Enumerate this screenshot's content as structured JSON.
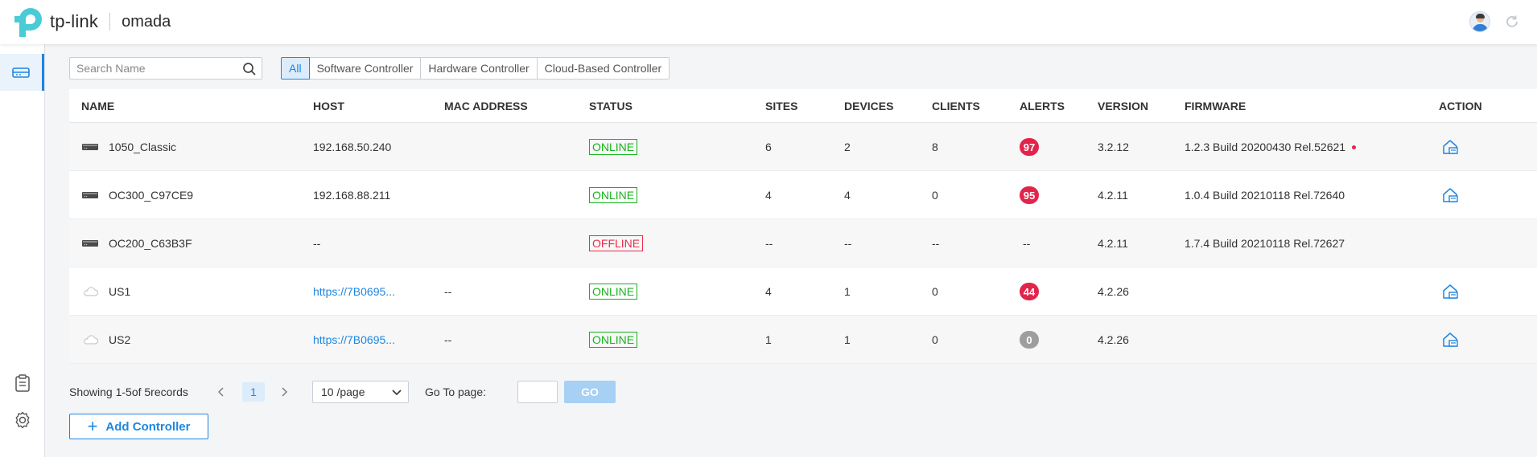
{
  "brand": {
    "name": "tp-link",
    "product": "omada",
    "accent": "#1f86e0"
  },
  "header": {
    "avatar_icon": "user-avatar-icon",
    "refresh_icon": "refresh-icon"
  },
  "sidebar": {
    "items": [
      {
        "icon": "controller-list-icon",
        "active": true
      },
      {
        "icon": "clipboard-icon",
        "active": false
      },
      {
        "icon": "gear-icon",
        "active": false
      }
    ]
  },
  "search": {
    "placeholder": "Search Name",
    "value": ""
  },
  "filters": [
    "All",
    "Software Controller",
    "Hardware Controller",
    "Cloud-Based Controller"
  ],
  "active_filter": "All",
  "table": {
    "columns": [
      "NAME",
      "HOST",
      "MAC ADDRESS",
      "STATUS",
      "SITES",
      "DEVICES",
      "CLIENTS",
      "ALERTS",
      "VERSION",
      "FIRMWARE",
      "ACTION"
    ],
    "rows": [
      {
        "type": "hardware",
        "name": "1050_Classic",
        "host": "192.168.50.240",
        "mac": "",
        "status": "ONLINE",
        "sites": "6",
        "devices": "2",
        "clients": "8",
        "alerts": "97",
        "version": "3.2.12",
        "firmware": "1.2.3 Build 20200430 Rel.52621",
        "firmware_update": true,
        "action": true
      },
      {
        "type": "hardware",
        "name": "OC300_C97CE9",
        "host": "192.168.88.211",
        "mac": "",
        "status": "ONLINE",
        "sites": "4",
        "devices": "4",
        "clients": "0",
        "alerts": "95",
        "version": "4.2.11",
        "firmware": "1.0.4 Build 20210118 Rel.72640",
        "firmware_update": false,
        "action": true
      },
      {
        "type": "hardware",
        "name": "OC200_C63B3F",
        "host": "--",
        "mac": "",
        "status": "OFFLINE",
        "sites": "--",
        "devices": "--",
        "clients": "--",
        "alerts": "--",
        "version": "4.2.11",
        "firmware": "1.7.4 Build 20210118 Rel.72627",
        "firmware_update": false,
        "action": false
      },
      {
        "type": "cloud",
        "name": "US1",
        "host": "https://7B0695...",
        "mac": "--",
        "status": "ONLINE",
        "sites": "4",
        "devices": "1",
        "clients": "0",
        "alerts": "44",
        "version": "4.2.26",
        "firmware": "",
        "firmware_update": false,
        "action": true
      },
      {
        "type": "cloud",
        "name": "US2",
        "host": "https://7B0695...",
        "mac": "--",
        "status": "ONLINE",
        "sites": "1",
        "devices": "1",
        "clients": "0",
        "alerts": "0",
        "version": "4.2.26",
        "firmware": "",
        "firmware_update": false,
        "action": true
      }
    ]
  },
  "pagination": {
    "summary": "Showing 1-5of  5records",
    "current_page": "1",
    "page_size": "10 /page",
    "goto_label": "Go To page:",
    "goto_value": "",
    "go_label": "GO"
  },
  "add_button": {
    "label": "Add Controller"
  },
  "colors": {
    "online": "#17b31d",
    "offline": "#e82c4a",
    "alert": "#e3244a",
    "alert_zero": "#9e9e9e"
  }
}
